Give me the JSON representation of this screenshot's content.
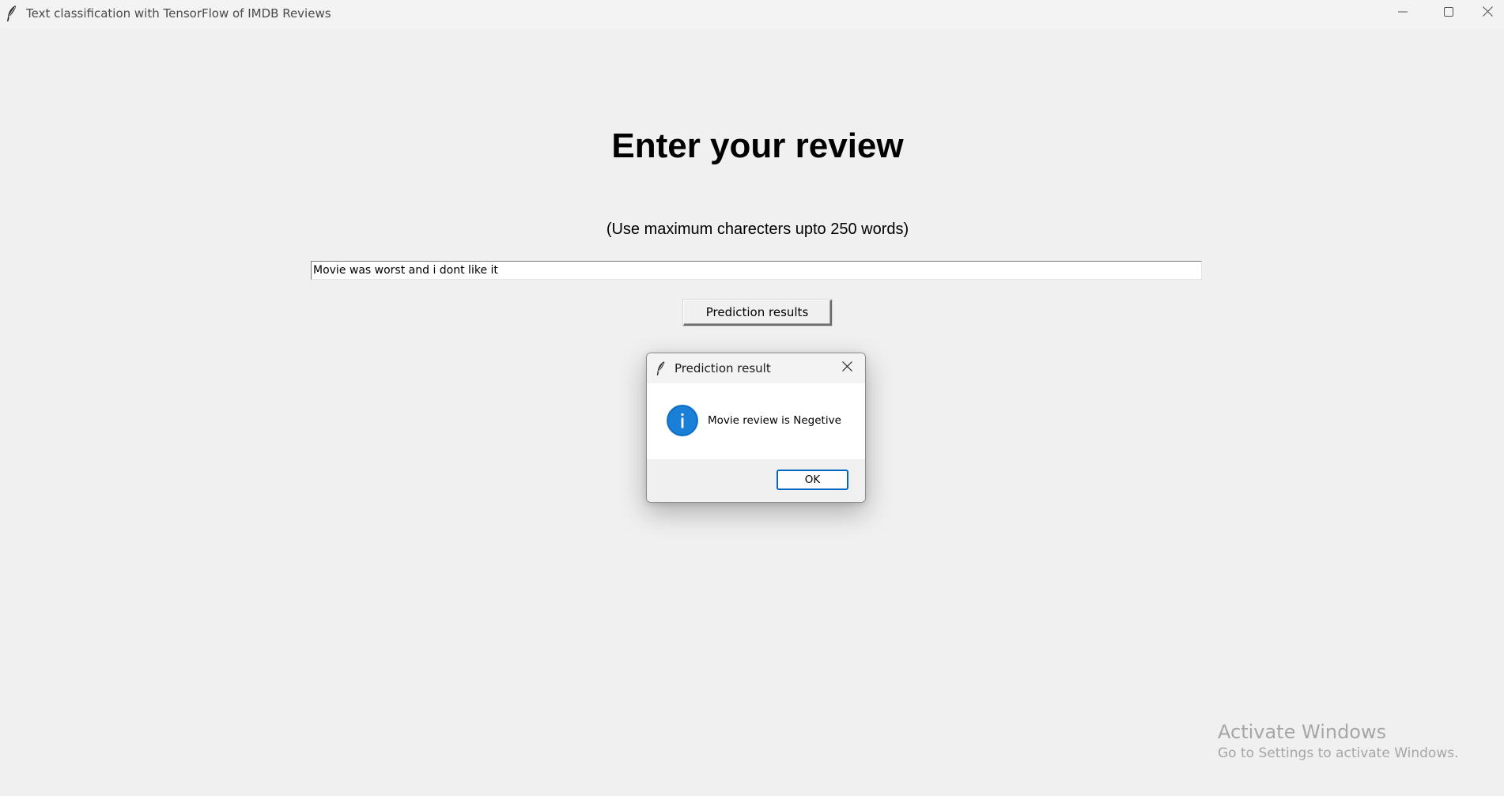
{
  "window": {
    "title": "Text classification with TensorFlow of IMDB Reviews",
    "icons": {
      "app": "feather-icon",
      "minimize": "minimize-icon",
      "maximize": "maximize-icon",
      "close": "close-icon"
    }
  },
  "main": {
    "heading": "Enter your review",
    "hint": "(Use maximum charecters upto 250 words)",
    "review_input_value": "Movie was worst and i dont like it",
    "predict_button_label": "Prediction results"
  },
  "dialog": {
    "title": "Prediction result",
    "message": "Movie review is Negetive",
    "ok_label": "OK",
    "icons": {
      "app": "feather-icon",
      "info": "info-icon",
      "close": "close-icon"
    },
    "accent_color": "#0067c0"
  },
  "watermark": {
    "title": "Activate Windows",
    "subtitle": "Go to Settings to activate Windows."
  }
}
